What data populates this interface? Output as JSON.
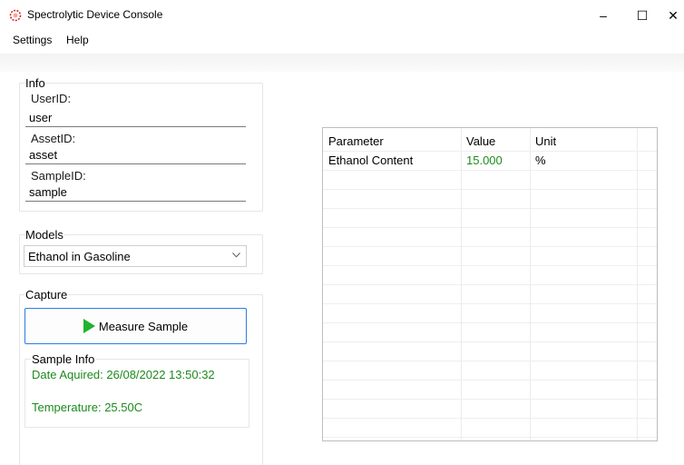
{
  "window": {
    "title": "Spectrolytic Device Console",
    "minimize_glyph": "–",
    "maximize_glyph": "☐",
    "close_glyph": "✕"
  },
  "menu": {
    "items": [
      "Settings",
      "Help"
    ]
  },
  "info": {
    "group_label": "Info",
    "user_label": "UserID:",
    "user_value": "user",
    "asset_label": "AssetID:",
    "asset_value": "asset",
    "sample_label": "SampleID:",
    "sample_value": "sample"
  },
  "models": {
    "group_label": "Models",
    "selected": "Ethanol in Gasoline"
  },
  "capture": {
    "group_label": "Capture",
    "measure_label": "Measure Sample"
  },
  "sample_info": {
    "group_label": "Sample Info",
    "date_text": "Date Aquired: 26/08/2022 13:50:32",
    "temperature_text": "Temperature: 25.50C"
  },
  "results": {
    "columns": [
      "Parameter",
      "Value",
      "Unit"
    ],
    "rows": [
      {
        "parameter": "Ethanol Content",
        "value": "15.000",
        "unit": "%"
      }
    ]
  },
  "colors": {
    "accent": "#2b7de0",
    "green_text": "#1c8a1c",
    "play_icon": "#1fb32e"
  },
  "icons": {
    "app": "spectrolytic-logo-icon",
    "measure": "play-icon",
    "dropdown": "chevron-down-icon"
  }
}
